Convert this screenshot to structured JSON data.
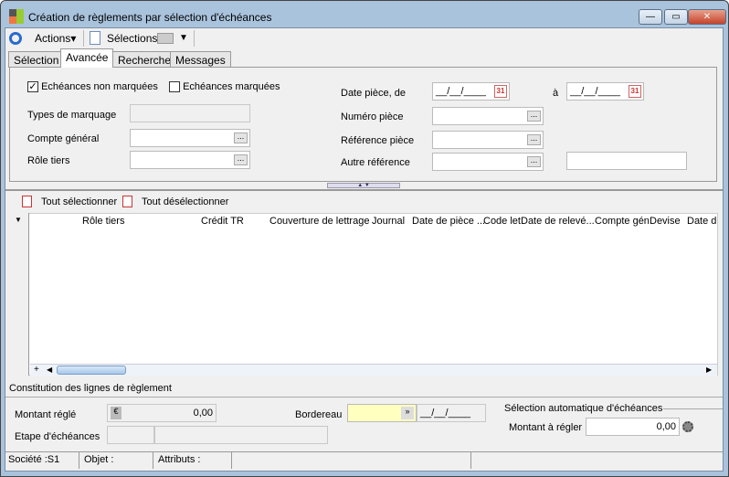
{
  "window": {
    "title": "Création de règlements par sélection d'échéances"
  },
  "toolbar": {
    "actions": "Actions",
    "selections": "Sélections"
  },
  "tabs": [
    "Sélection",
    "Avancée",
    "Recherche",
    "Messages"
  ],
  "advanced": {
    "cb_unmarked": "Echéances non marquées",
    "cb_unmarked_checked": true,
    "cb_marked": "Echéances marquées",
    "cb_marked_checked": false,
    "types_marquage": "Types de marquage",
    "compte_general": "Compte général",
    "role_tiers": "Rôle tiers",
    "date_piece": "Date pièce, de",
    "date_from": "__/__/____",
    "a": "à",
    "date_to": "__/__/____",
    "cal": "31",
    "numero_piece": "Numéro pièce",
    "reference_piece": "Référence pièce",
    "autre_reference": "Autre référence"
  },
  "grid": {
    "select_all": "Tout sélectionner",
    "deselect_all": "Tout désélectionner",
    "columns": [
      "Rôle tiers",
      "Crédit TR",
      "Couverture de lettrage",
      "Journal",
      "Date de pièce ...",
      "Code let",
      "Date de relevé...",
      "Compte gén",
      "Devise",
      "Date d"
    ]
  },
  "section_title": "Constitution des lignes de règlement",
  "bottom": {
    "montant_regle": "Montant réglé",
    "montant_regle_value": "0,00",
    "etape": "Etape d'échéances",
    "bordereau": "Bordereau",
    "bordereau_date": "__/__/____",
    "auto_group": "Sélection automatique d'échéances",
    "montant_a_regler": "Montant à régler",
    "montant_a_regler_value": "0,00"
  },
  "status": {
    "societe": "Société :S1",
    "objet": "Objet :",
    "attributs": "Attributs :"
  }
}
